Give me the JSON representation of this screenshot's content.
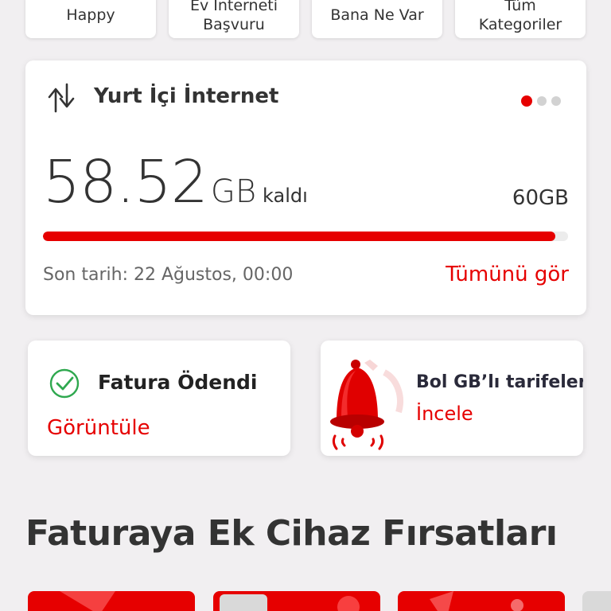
{
  "top_categories": [
    {
      "line1": "Happy",
      "line2": ""
    },
    {
      "line1": "Ev İnterneti",
      "line2": "Başvuru"
    },
    {
      "line1": "Bana Ne Var",
      "line2": ""
    },
    {
      "line1": "Tüm",
      "line2": "Kategoriler"
    }
  ],
  "usage_card": {
    "title": "Yurt İçi İnternet",
    "remaining_value": "58.52",
    "remaining_unit": "GB",
    "remaining_label": "kaldı",
    "total": "60GB",
    "remaining_fraction": 0.975,
    "deadline": "Son tarih: 22 Ağustos, 00:00",
    "see_all": "Tümünü gör",
    "carousel_pages": 3,
    "carousel_active": 0,
    "icon": "arrows-up-down-icon"
  },
  "bill_card": {
    "title": "Fatura Ödendi",
    "action": "Görüntüle",
    "icon": "check-circle-icon"
  },
  "promo_card": {
    "title": "Bol GB’lı tarifeler!",
    "action": "İncele",
    "icon": "bell-icon"
  },
  "section_title": "Faturaya Ek Cihaz Fırsatları",
  "colors": {
    "accent": "#e60000",
    "background": "#f1eff1",
    "card": "#ffffff",
    "check": "#2fa84f"
  }
}
